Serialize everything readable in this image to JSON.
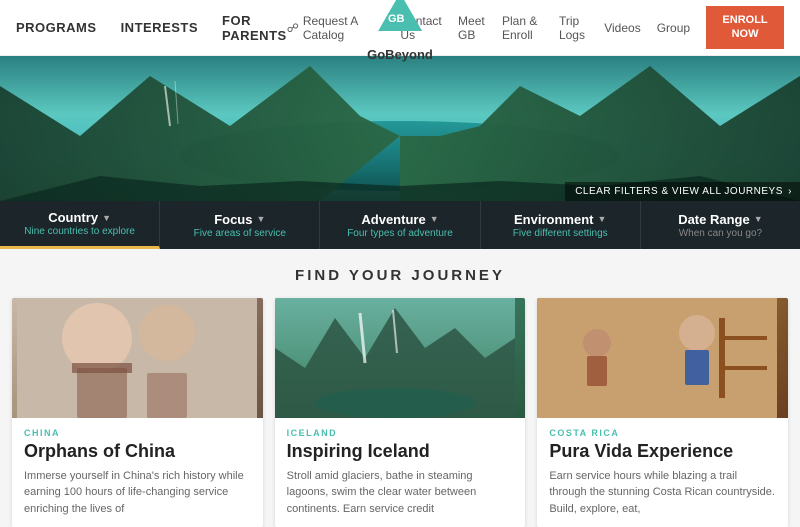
{
  "topbar": {
    "nav_items": [
      "Programs",
      "Interests",
      "For Parents"
    ],
    "utility": {
      "catalog": "Request A Catalog",
      "contact": "Contact Us"
    },
    "secondary_nav": [
      "Meet GB",
      "Plan & Enroll",
      "Trip Logs",
      "Videos",
      "Group"
    ],
    "logo_text": "GoBeyond",
    "enroll_label": "ENROLL NOW"
  },
  "filters": {
    "clear_label": "CLEAR FILTERS & VIEW ALL JOURNEYS",
    "items": [
      {
        "label": "Country",
        "sublabel": "Nine countries to explore",
        "sublabel_color": "teal",
        "active": true
      },
      {
        "label": "Focus",
        "sublabel": "Five areas of service",
        "sublabel_color": "teal",
        "active": false
      },
      {
        "label": "Adventure",
        "sublabel": "Four types of adventure",
        "sublabel_color": "teal",
        "active": false
      },
      {
        "label": "Environment",
        "sublabel": "Five different settings",
        "sublabel_color": "teal",
        "active": false
      },
      {
        "label": "Date Range",
        "sublabel": "When can you go?",
        "sublabel_color": "gray",
        "active": false
      }
    ]
  },
  "section_title": "FIND YOUR JOURNEY",
  "cards": [
    {
      "country": "CHINA",
      "title": "Orphans of China",
      "desc": "Immerse yourself in China's rich history while earning 100 hours of life-changing service enriching the lives of",
      "img_type": "china"
    },
    {
      "country": "ICELAND",
      "title": "Inspiring Iceland",
      "desc": "Stroll amid glaciers, bathe in steaming lagoons, swim the clear water between continents. Earn service credit",
      "img_type": "iceland"
    },
    {
      "country": "COSTA RICA",
      "title": "Pura Vida Experience",
      "desc": "Earn service hours while blazing a trail through the stunning Costa Rican countryside. Build, explore, eat,",
      "img_type": "costarica"
    }
  ]
}
